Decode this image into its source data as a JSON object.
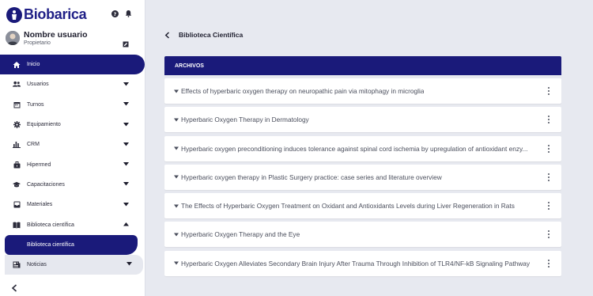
{
  "brand": {
    "name": "Biobarica"
  },
  "top_icons": [
    "help-icon",
    "bell-icon"
  ],
  "user": {
    "name": "Nombre usuario",
    "role": "Propietario"
  },
  "sidebar": {
    "items": [
      {
        "label": "Inicio",
        "icon": "home-icon",
        "active": true
      },
      {
        "label": "Usuarios",
        "icon": "users-icon"
      },
      {
        "label": "Turnos",
        "icon": "calendar-icon"
      },
      {
        "label": "Equipamiento",
        "icon": "gear-icon"
      },
      {
        "label": "CRM",
        "icon": "bar-chart-icon"
      },
      {
        "label": "Hipermed",
        "icon": "briefcase-icon"
      },
      {
        "label": "Capacitaciones",
        "icon": "graduation-cap-icon"
      },
      {
        "label": "Materiales",
        "icon": "inbox-icon"
      },
      {
        "label": "Biblioteca científica",
        "icon": "book-icon",
        "expanded": true
      }
    ],
    "sub_items": [
      {
        "label": "Biblioteca científica"
      }
    ],
    "after": [
      {
        "label": "Noticias",
        "icon": "news-icon"
      }
    ]
  },
  "page": {
    "title": "Biblioteca Científica"
  },
  "archivos": {
    "header": "ARCHIVOS",
    "files": [
      "Effects of hyperbaric oxygen therapy on neuropathic pain via mitophagy in microglia",
      "Hyperbaric Oxygen Therapy in Dermatology",
      "Hyperbaric oxygen preconditioning induces tolerance against spinal cord ischemia by upregulation of antioxidant enzy...",
      "Hyperbaric oxygen therapy in Plastic Surgery practice: case series and literature overview",
      "The Effects of Hyperbaric Oxygen Treatment on Oxidant and Antioxidants Levels during Liver Regeneration in Rats",
      "Hyperbaric Oxygen Therapy and the Eye",
      "Hyperbaric Oxygen Alleviates Secondary Brain Injury After Trauma Through Inhibition of TLR4/NF-kB Signaling Pathway"
    ]
  },
  "colors": {
    "primary": "#1a1a7a",
    "background": "#e7e9f0",
    "surface": "#ffffff"
  }
}
